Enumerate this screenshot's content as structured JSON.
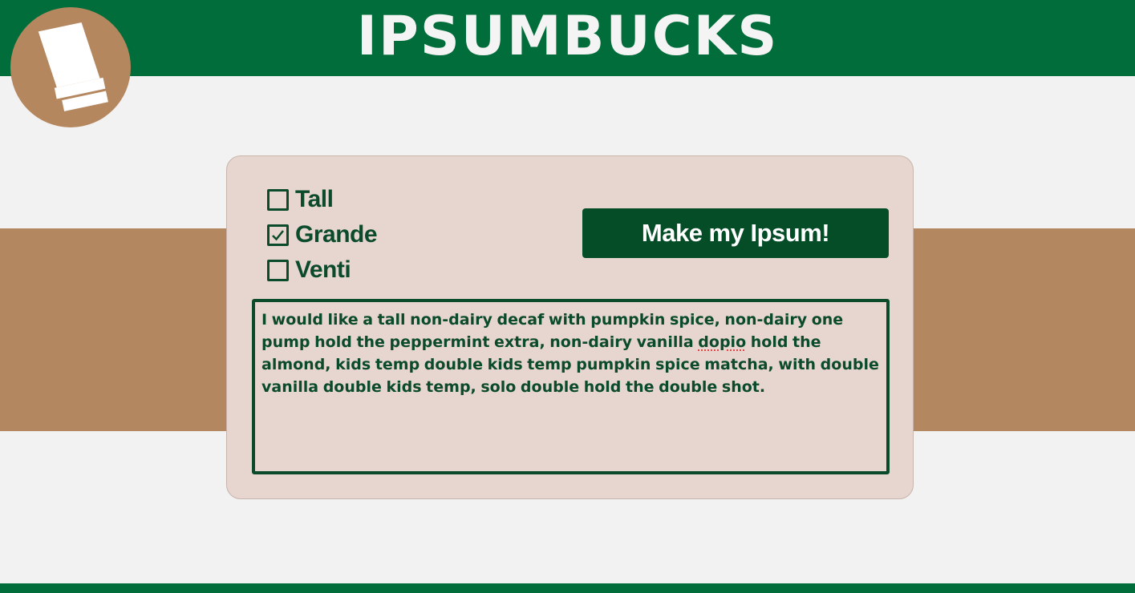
{
  "header": {
    "title": "IPSUMBUCKS"
  },
  "logo": {
    "icon": "coffee-cup-icon",
    "bg_color": "#b5875f"
  },
  "colors": {
    "brand_green": "#006d3b",
    "dark_green": "#044d27",
    "band_brown": "#b3875f",
    "card_bg": "#e7d6cf",
    "page_bg": "#f2f2f2"
  },
  "sizes": [
    {
      "label": "Tall",
      "checked": false
    },
    {
      "label": "Grande",
      "checked": true
    },
    {
      "label": "Venti",
      "checked": false
    }
  ],
  "make_button": {
    "label": "Make my Ipsum!"
  },
  "output": {
    "text_before": "I would like a tall non-dairy decaf with pumpkin spice, non-dairy one pump hold the peppermint extra, non-dairy vanilla ",
    "misspelled_word": "dopio",
    "text_after": " hold the almond, kids temp double kids temp pumpkin spice matcha, with double vanilla double kids temp, solo double hold the double shot."
  }
}
